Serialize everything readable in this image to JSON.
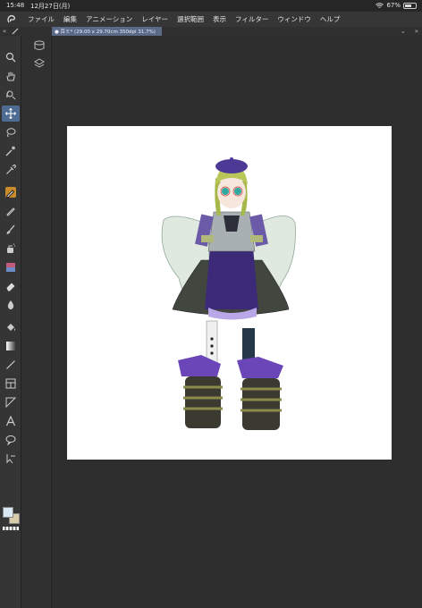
{
  "status": {
    "time": "15:48",
    "date": "12月27日(月)",
    "battery": "67%",
    "battery_level": 0.67
  },
  "menu": {
    "items": [
      "ファイル",
      "編集",
      "アニメーション",
      "レイヤー",
      "選択範囲",
      "表示",
      "フィルター",
      "ウィンドウ",
      "ヘルプ"
    ]
  },
  "document_tab": {
    "label": "● 百ミ* (29.00 x 29.70cm 350dpi 31.7%)"
  },
  "colors": {
    "main": "#d9e8f2",
    "sub": "#d8cda8",
    "accent": "#4e6b91"
  },
  "tools": [
    "search-icon",
    "hand-icon",
    "rotate-icon",
    "move-icon",
    "lasso-icon",
    "magic-wand-icon",
    "eyedropper-icon",
    "pen-icon",
    "pencil-icon",
    "brush-icon",
    "airbrush-icon",
    "decoration-icon",
    "eraser-icon",
    "blend-icon",
    "fill-icon",
    "gradient-icon",
    "line-icon",
    "frame-icon",
    "ruler-icon",
    "text-icon",
    "balloon-icon",
    "correct-line-icon"
  ]
}
